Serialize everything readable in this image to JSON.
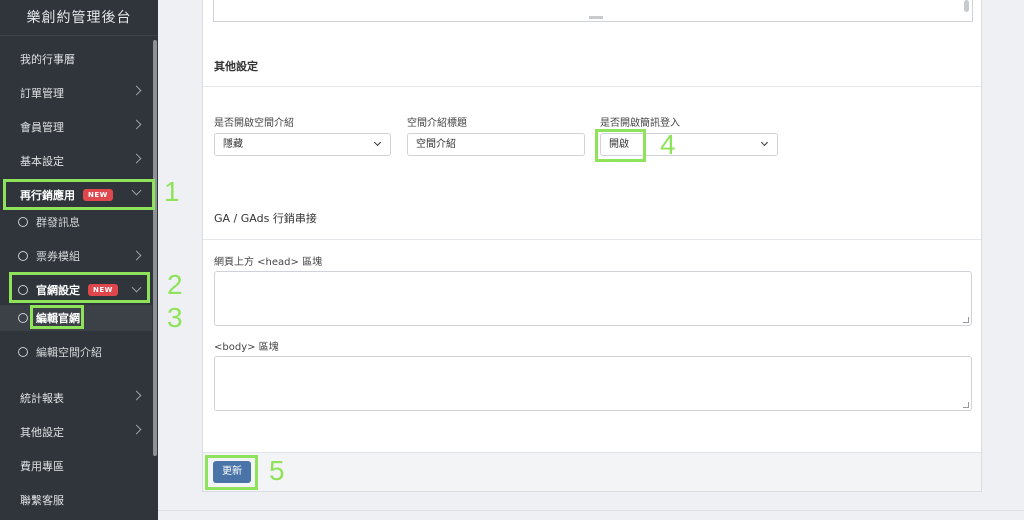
{
  "sidebar": {
    "brand": "樂創約管理後台",
    "items": {
      "calendar": "我的行事曆",
      "orders": "訂單管理",
      "members": "會員管理",
      "basic": "基本設定",
      "remarketing": "再行銷應用",
      "broadcast": "群發訊息",
      "tickets": "票券模組",
      "website": "官網設定",
      "edit_site": "編輯官網",
      "edit_space": "編輯空間介紹",
      "reports": "統計報表",
      "others": "其他設定",
      "billing": "費用專區",
      "contact": "聯繫客服"
    },
    "new_badge": "NEW"
  },
  "main": {
    "other_settings_title": "其他設定",
    "fields": {
      "space_intro_label": "是否開啟空間介紹",
      "space_intro_value": "隱藏",
      "space_title_label": "空間介紹標題",
      "space_title_value": "空間介紹",
      "sms_login_label": "是否開啟簡訊登入",
      "sms_login_value": "開啟"
    },
    "ga_title": "GA / GAds 行銷串接",
    "head_label": "網頁上方 <head> 區塊",
    "body_label": "<body> 區塊",
    "update_button": "更新"
  },
  "callouts": [
    "1",
    "2",
    "3",
    "4",
    "5"
  ],
  "colors": {
    "highlight": "#8fe35a",
    "sidebar_bg": "#2f353a",
    "primary_button": "#4a74a8",
    "new_badge": "#e0474c"
  }
}
